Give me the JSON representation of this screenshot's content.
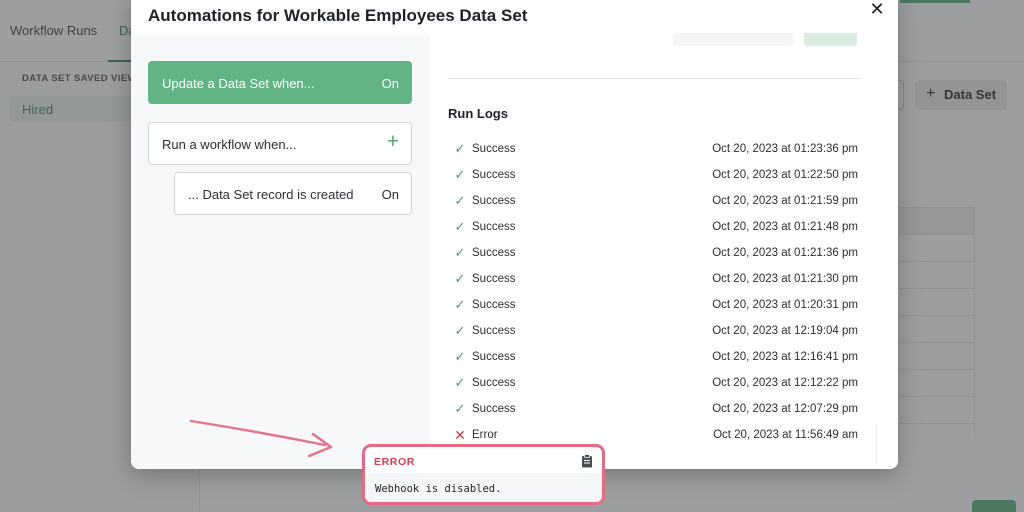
{
  "background": {
    "tabs": [
      "Workflow Runs",
      "Da"
    ],
    "sidebar_heading": "DATA SET SAVED VIEW",
    "sidebar_item": "Hired",
    "add_dataset_label": "Data Set"
  },
  "modal": {
    "title": "Automations for Workable Employees Data Set",
    "automations": {
      "update_label": "Update a Data Set when...",
      "update_state": "On",
      "run_label": "Run a workflow when...",
      "sub_label": "... Data Set record is created",
      "sub_state": "On"
    },
    "run_logs_title": "Run Logs",
    "run_logs": [
      {
        "status": "Success",
        "timestamp": "Oct 20, 2023 at 01:23:36 pm"
      },
      {
        "status": "Success",
        "timestamp": "Oct 20, 2023 at 01:22:50 pm"
      },
      {
        "status": "Success",
        "timestamp": "Oct 20, 2023 at 01:21:59 pm"
      },
      {
        "status": "Success",
        "timestamp": "Oct 20, 2023 at 01:21:48 pm"
      },
      {
        "status": "Success",
        "timestamp": "Oct 20, 2023 at 01:21:36 pm"
      },
      {
        "status": "Success",
        "timestamp": "Oct 20, 2023 at 01:21:30 pm"
      },
      {
        "status": "Success",
        "timestamp": "Oct 20, 2023 at 01:20:31 pm"
      },
      {
        "status": "Success",
        "timestamp": "Oct 20, 2023 at 12:19:04 pm"
      },
      {
        "status": "Success",
        "timestamp": "Oct 20, 2023 at 12:16:41 pm"
      },
      {
        "status": "Success",
        "timestamp": "Oct 20, 2023 at 12:12:22 pm"
      },
      {
        "status": "Success",
        "timestamp": "Oct 20, 2023 at 12:07:29 pm"
      },
      {
        "status": "Error",
        "timestamp": "Oct 20, 2023 at 11:56:49 am"
      }
    ]
  },
  "error_toast": {
    "title": "ERROR",
    "message": "Webhook is disabled.",
    "icon": "clipboard-icon"
  },
  "colors": {
    "accent_green": "#62b485",
    "success_green": "#3f9a6a",
    "error_red": "#d8394a",
    "toast_border": "#e66a84"
  }
}
